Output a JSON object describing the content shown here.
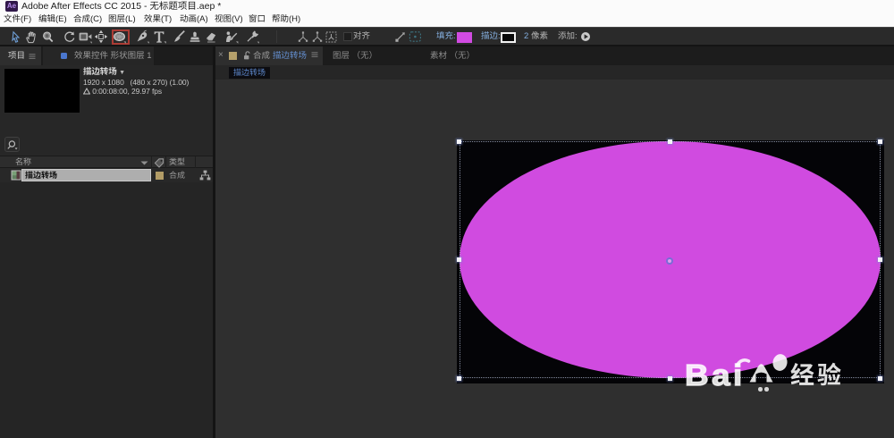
{
  "window": {
    "app_icon": "Ae",
    "title": "Adobe After Effects CC 2015 - 无标题项目.aep *"
  },
  "menu": {
    "items": [
      "文件(F)",
      "编辑(E)",
      "合成(C)",
      "图层(L)",
      "效果(T)",
      "动画(A)",
      "视图(V)",
      "窗口",
      "帮助(H)"
    ]
  },
  "toolbar": {
    "tools": [
      "selection",
      "hand",
      "zoom",
      "rotation",
      "camera",
      "pan-behind",
      "ellipse",
      "pen",
      "text",
      "brush",
      "clone-stamp",
      "eraser",
      "roto-brush",
      "puppet-pin"
    ],
    "active_tool": "selection",
    "highlighted_tool": "ellipse",
    "snap_label": "对齐",
    "fill_label": "填充:",
    "fill_color": "#d14be2",
    "stroke_label": "描边:",
    "stroke_width_value": "2",
    "stroke_width_unit": "像素",
    "add_label": "添加:"
  },
  "project_panel": {
    "tab_project": "项目",
    "tab_effect_controls": "效果控件 形状图层 1",
    "preview": {
      "name": "描边转场",
      "dropdown": "▼",
      "details": "1920 x 1080   (480 x 270) (1.00)",
      "timing": "0:00:08:00, 29.97 fps"
    },
    "columns": {
      "name": "名称",
      "type": "类型"
    },
    "rows": [
      {
        "name": "描边转场",
        "type": "合成",
        "label_color": "#b29c66"
      }
    ]
  },
  "composition_panel": {
    "active_tab": {
      "close_glyph": "×",
      "prefix": "合成",
      "name": "描边转场"
    },
    "tab_layer": "图层 （无）",
    "tab_footage": "素材 （无）",
    "breadcrumb": "描边转场",
    "comp": {
      "background": "#040407"
    },
    "shape": {
      "type": "ellipse",
      "fill": "#d04be0"
    }
  },
  "watermark": {
    "latin": "Bai",
    "cjk": "经验"
  }
}
